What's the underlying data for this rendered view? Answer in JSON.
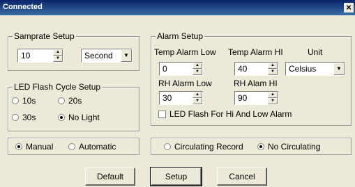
{
  "window": {
    "title": "Connected",
    "close_glyph": "×"
  },
  "samprate": {
    "group_label": "Samprate Setup",
    "value": "10",
    "unit": "Second"
  },
  "led_cycle": {
    "group_label": "LED Flash Cycle Setup",
    "options": [
      "10s",
      "20s",
      "30s",
      "No Light"
    ],
    "selected": "No Light"
  },
  "alarm": {
    "group_label": "Alarm Setup",
    "temp_low_label": "Temp Alarm Low",
    "temp_high_label": "Temp Alarm HI",
    "unit_label": "Unit",
    "temp_low": "0",
    "temp_high": "40",
    "unit_value": "Celsius",
    "rh_low_label": "RH Alarm Low",
    "rh_high_label": "RH Alam HI",
    "rh_low": "30",
    "rh_high": "90",
    "led_flash_label": "LED Flash For Hi And Low  Alarm"
  },
  "mode": {
    "options": [
      "Manual",
      "Automatic"
    ],
    "selected": "Manual"
  },
  "record": {
    "options": [
      "Circulating Record",
      "No Circulating"
    ],
    "selected": "No Circulating"
  },
  "buttons": {
    "default": "Default",
    "setup": "Setup",
    "cancel": "Cancel"
  }
}
